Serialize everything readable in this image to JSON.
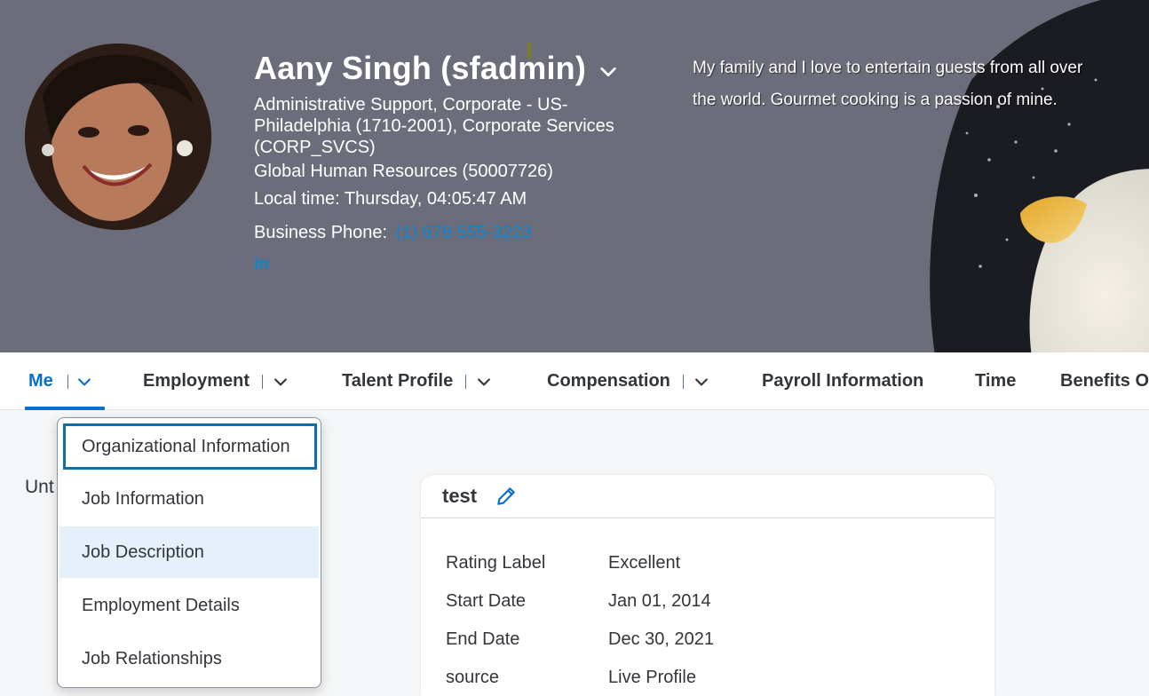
{
  "profile": {
    "name": "Aany Singh (sfadmin)",
    "department": "Administrative Support, Corporate - US-Philadelphia (1710-2001), Corporate Services (CORP_SVCS)",
    "org": "Global Human Resources (50007726)",
    "local_time": "Local time: Thursday, 04:05:47 AM",
    "phone_label": "Business Phone:",
    "phone_value": "(1) 678 555-3223",
    "linkedin_label": "in",
    "about": "My family and I love to entertain guests from all over the world. Gourmet cooking is a passion of mine."
  },
  "tabs": [
    {
      "label": "Me",
      "has_menu": true,
      "active": true
    },
    {
      "label": "Employment",
      "has_menu": true
    },
    {
      "label": "Talent Profile",
      "has_menu": true
    },
    {
      "label": "Compensation",
      "has_menu": true
    },
    {
      "label": "Payroll Information",
      "has_menu": false
    },
    {
      "label": "Time",
      "has_menu": false
    },
    {
      "label": "Benefits O",
      "has_menu": false
    }
  ],
  "dropdown": {
    "items": [
      {
        "label": "Organizational Information",
        "state": "focused"
      },
      {
        "label": "Job Information",
        "state": "normal"
      },
      {
        "label": "Job Description",
        "state": "hover"
      },
      {
        "label": "Employment Details",
        "state": "normal"
      },
      {
        "label": "Job Relationships",
        "state": "normal"
      }
    ]
  },
  "partial_text": "Unt",
  "card": {
    "title": "test",
    "fields": [
      {
        "label": "Rating Label",
        "value": "Excellent"
      },
      {
        "label": "Start Date",
        "value": "Jan 01, 2014"
      },
      {
        "label": "End Date",
        "value": "Dec 30, 2021"
      },
      {
        "label": "source",
        "value": "Live Profile"
      }
    ]
  },
  "colors": {
    "header_bg": "#6c6d7a",
    "accent": "#0a6ed1",
    "link": "#0e85d0",
    "page_bg": "#f5f6f7"
  }
}
